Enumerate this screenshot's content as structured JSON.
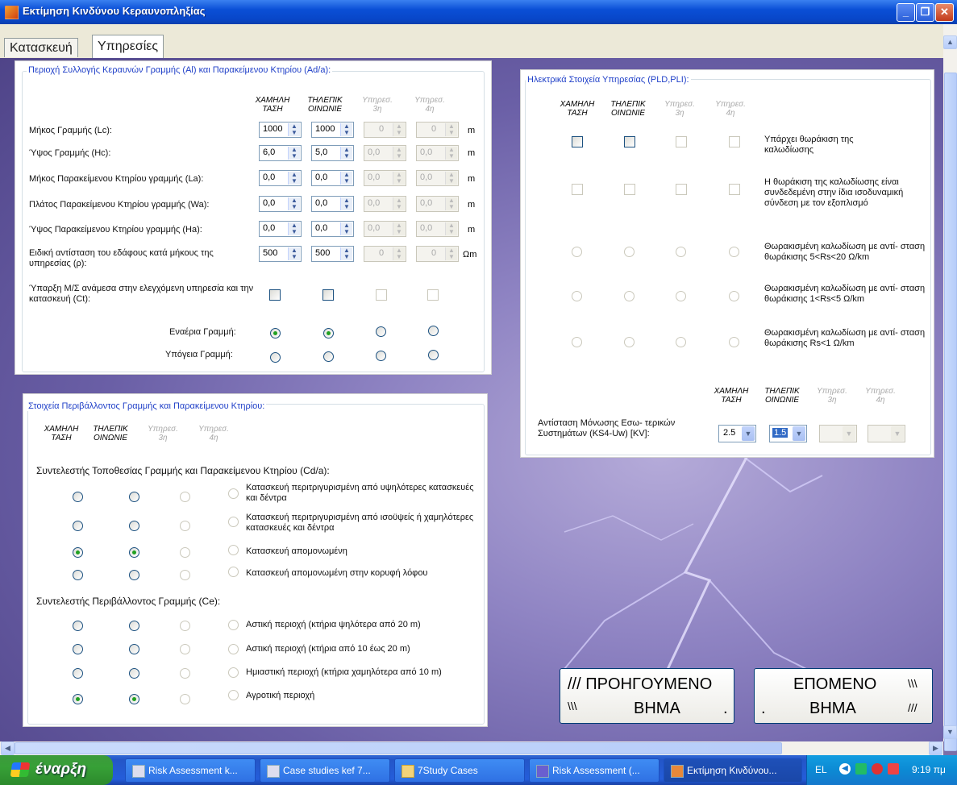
{
  "window": {
    "title": "Εκτίμηση Κινδύνου Κεραυνοπληξίας"
  },
  "tabs": [
    "Κατασκευή",
    "Υπηρεσίες"
  ],
  "columns": [
    {
      "l1": "ΧΑΜΗΛΗ",
      "l2": "ΤΑΣΗ"
    },
    {
      "l1": "ΤΗΛΕΠΙΚ",
      "l2": "ΟΙΝΩΝΙΕ"
    },
    {
      "l1": "Υπηρεσ.",
      "l2": "3η"
    },
    {
      "l1": "Υπηρεσ.",
      "l2": "4η"
    }
  ],
  "area_group": {
    "legend": "Περιοχή Συλλογής Κεραυνών Γραμμής (Al) και Παρακείμενου Κτηρίου (Ad/a):",
    "rows": [
      {
        "label": "Μήκος Γραμμής (Lc):",
        "values": [
          "1000",
          "1000",
          "0",
          "0"
        ],
        "unit": "m"
      },
      {
        "label": "Ύψος Γραμμής (Hc):",
        "values": [
          "6,0",
          "5,0",
          "0,0",
          "0,0"
        ],
        "unit": "m"
      },
      {
        "label": "Μήκος Παρακείμενου Κτηρίου γραμμής (La):",
        "values": [
          "0,0",
          "0,0",
          "0,0",
          "0,0"
        ],
        "unit": "m"
      },
      {
        "label": "Πλάτος Παρακείμενου Κτηρίου γραμμής (Wa):",
        "values": [
          "0,0",
          "0,0",
          "0,0",
          "0,0"
        ],
        "unit": "m"
      },
      {
        "label": "Ύψος Παρακείμενου Κτηρίου γραμμής (Ha):",
        "values": [
          "0,0",
          "0,0",
          "0,0",
          "0,0"
        ],
        "unit": "m"
      },
      {
        "label": "Ειδική αντίσταση του εδάφους κατά μήκους της υπηρεσίας (ρ):",
        "values": [
          "500",
          "500",
          "0",
          "0"
        ],
        "unit": "Ωm"
      }
    ],
    "transformer_label": "Ύπαρξη Μ/Σ ανάμεσα στην ελεγχόμενη υπηρεσία και την κατασκευή (Ct):",
    "overhead_label": "Εναέρια Γραμμή:",
    "underground_label": "Υπόγεια Γραμμή:"
  },
  "env_group": {
    "legend": "Στοιχεία Περιβάλλοντος Γραμμής και Παρακείμενου Κτηρίου:",
    "cd_title": "Συντελεστής Τοποθεσίας Γραμμής και Παρακείμενου Κτηρίου (Cd/a):",
    "cd_options": [
      "Κατασκευή περιτριγυρισμένη από υψηλότερες κατασκευές και δέντρα",
      "Κατασκευή περιτριγυρισμένη από ισοϋψείς ή χαμηλότερες κατασκευές και δέντρα",
      "Κατασκευή απομονωμένη",
      "Κατασκευή απομονωμένη στην κορυφή λόφου"
    ],
    "ce_title": "Συντελεστής Περιβάλλοντος Γραμμής (Ce):",
    "ce_options": [
      "Αστική περιοχή (κτήρια ψηλότερα από 20 m)",
      "Αστική περιοχή (κτήρια από 10 έως 20 m)",
      "Ημιαστική περιοχή (κτήρια χαμηλότερα από 10 m)",
      "Αγροτική περιοχή"
    ]
  },
  "elec_group": {
    "legend": "Ηλεκτρικά Στοιχεία Υπηρεσίας (PLD,PLI):",
    "shield_label": "Υπάρχει θωράκιση της καλωδίωσης",
    "bonded_label": "Η θωράκιση της καλωδίωσης είναι συνδεδεμένη στην ίδια ισοδυναμική σύνδεση με τον εξοπλισμό",
    "rs_options": [
      "Θωρακισμένη καλωδίωση με αντί- σταση θωράκισης 5<Rs<20 Ω/km",
      "Θωρακισμένη καλωδίωση με αντί- σταση θωράκισης 1<Rs<5 Ω/km",
      "Θωρακισμένη καλωδίωση με αντί- σταση θωράκισης Rs<1 Ω/km"
    ],
    "ks4_label": "Αντίσταση Μόνωσης Εσω- τερικών Συστημάτων (KS4-Uw) [KV]:",
    "ks4_values": [
      "2.5",
      "1.5",
      "",
      ""
    ]
  },
  "buttons": {
    "prev_line1": "/// ΠΡΟΗΓΟΥΜΕΝΟ",
    "prev_slashes": "\\\\\\",
    "prev_line2": "ΒΗΜΑ",
    "prev_dot": ".",
    "next_line1": "ΕΠΟΜΕΝΟ",
    "next_slashes": "\\\\\\",
    "next_dot": ".",
    "next_line2": "ΒΗΜΑ",
    "next_slashes2": "///"
  },
  "taskbar": {
    "start": "έναρξη",
    "items": [
      "Risk Assessment  k...",
      "Case studies kef 7...",
      "7Study Cases",
      "Risk Assessment (...",
      "Εκτίμηση Κινδύνου..."
    ],
    "lang": "EL",
    "clock": "9:19 πμ"
  },
  "colors": {
    "accent": "#2040c8",
    "radio_on": "#21a121",
    "title_bar": "#0a4fd6"
  }
}
